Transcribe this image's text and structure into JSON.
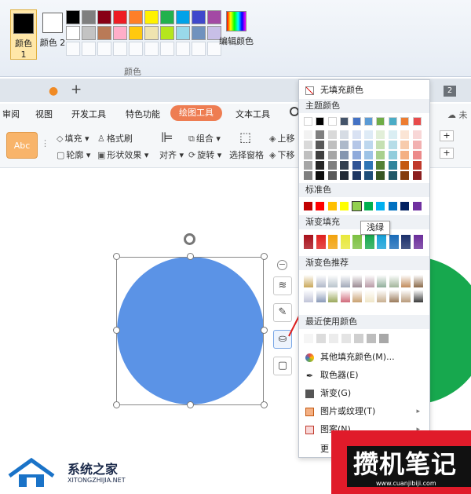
{
  "paint": {
    "color1_label": "颜色 1",
    "color2_label": "颜色 2",
    "edit_colors_label": "编辑颜色",
    "group_label": "颜色",
    "palette_row1": [
      "#000000",
      "#7f7f7f",
      "#880015",
      "#ed1c24",
      "#ff7f27",
      "#fff200",
      "#22b14c",
      "#00a2e8",
      "#3f48cc",
      "#a349a4"
    ],
    "palette_row2": [
      "#ffffff",
      "#c3c3c3",
      "#b97a57",
      "#ffaec9",
      "#ffc90e",
      "#efe4b0",
      "#b5e61d",
      "#99d9ea",
      "#7092be",
      "#c8bfe7"
    ]
  },
  "wps": {
    "page_badge": "2",
    "menus": [
      "审阅",
      "视图",
      "开发工具",
      "特色功能",
      "绘图工具",
      "文本工具"
    ],
    "unsync": "未",
    "style_sample": "Abc",
    "toolbar": {
      "fill": "填充",
      "format_painter": "格式刷",
      "outline": "轮廓",
      "shape_effects": "形状效果",
      "align": "对齐",
      "group": "组合",
      "rotate": "旋转",
      "selection_pane": "选择窗格",
      "up": "上移",
      "down": "下移"
    }
  },
  "dropdown": {
    "no_fill": "无填充颜色",
    "theme_colors": "主题颜色",
    "standard_colors": "标准色",
    "gradient_fill": "渐变填充",
    "gradient_recommend": "渐变色推荐",
    "recent_colors": "最近使用颜色",
    "more_fill_colors": "其他填充颜色(M)...",
    "eyedropper": "取色器(E)",
    "gradient": "渐变(G)",
    "picture_texture": "图片或纹理(T)",
    "pattern": "图案(N)",
    "more": "更",
    "tooltip": "浅绿",
    "theme_top": [
      "#ffffff",
      "#000000",
      "#ffffff",
      "#44546a",
      "#4472c4",
      "#5b9bd5",
      "#70ad47",
      "#4bacc6",
      "#ed7d31",
      "#e84b4b"
    ],
    "theme_shades": [
      [
        "#f2f2f2",
        "#7f7f7f",
        "#d9d9d9",
        "#d6dce4",
        "#d9e2f3",
        "#deebf6",
        "#e2efd9",
        "#daeef3",
        "#fbe5d5",
        "#f8d7d7"
      ],
      [
        "#d9d9d9",
        "#595959",
        "#bfbfbf",
        "#adb9ca",
        "#b4c6e7",
        "#bdd7ee",
        "#c5e0b3",
        "#b6dde8",
        "#f7cbac",
        "#f2b1b1"
      ],
      [
        "#bfbfbf",
        "#3f3f3f",
        "#a6a6a6",
        "#8496b0",
        "#8eaadb",
        "#9dc3e6",
        "#a8d08d",
        "#92cddc",
        "#f4b083",
        "#ec8a8a"
      ],
      [
        "#a6a6a6",
        "#262626",
        "#7f7f7f",
        "#323f4f",
        "#2f5496",
        "#2e75b5",
        "#538135",
        "#31849b",
        "#c45911",
        "#c0392b"
      ],
      [
        "#7f7f7f",
        "#0d0d0d",
        "#595959",
        "#222a35",
        "#1f3864",
        "#1e4e79",
        "#375623",
        "#205867",
        "#843c0c",
        "#8b1f1f"
      ]
    ],
    "standard": [
      "#c00000",
      "#ff0000",
      "#ffc000",
      "#ffff00",
      "#92d050",
      "#00b050",
      "#00b0f0",
      "#0070c0",
      "#002060",
      "#7030a0"
    ],
    "gradient_fill_colors": [
      "#a8101a",
      "#e0201e",
      "#f2a20c",
      "#e8e83a",
      "#7cc041",
      "#17a84e",
      "#14a0d8",
      "#1a6bb8",
      "#1b2f6a",
      "#6a2d9a"
    ],
    "recommend": [
      [
        "#c9a85a",
        "#b0b8c8",
        "#b9c4cc",
        "#a0a8b8",
        "#9a8a92",
        "#b89aa6",
        "#8fae9a",
        "#a1b59a",
        "#c08a5a",
        "#8a6a4a"
      ],
      [
        "#c0c4d8",
        "#8a9ab8",
        "#9aa85a",
        "#d06a7a",
        "#c8a070",
        "#f0e6c8",
        "#c8b090",
        "#9a7a5a",
        "#b89a7a",
        "#3a3a3a"
      ]
    ],
    "recent": [
      "#f5f5f5",
      "#dcdcdc",
      "#ececec",
      "#e4e4e4",
      "#cfcfcf",
      "#bdbdbd",
      "#a8a8a8"
    ]
  },
  "canvas": {
    "blue_circle_color": "#5b93e6",
    "green_circle_color": "#17a84e",
    "annotation_color": "#e0201e"
  },
  "watermarks": {
    "left_title": "系统之家",
    "left_sub": "XITONGZHIJIA.NET",
    "right_title": "攒机笔记",
    "right_url": "www.cuanjibiji.com"
  }
}
